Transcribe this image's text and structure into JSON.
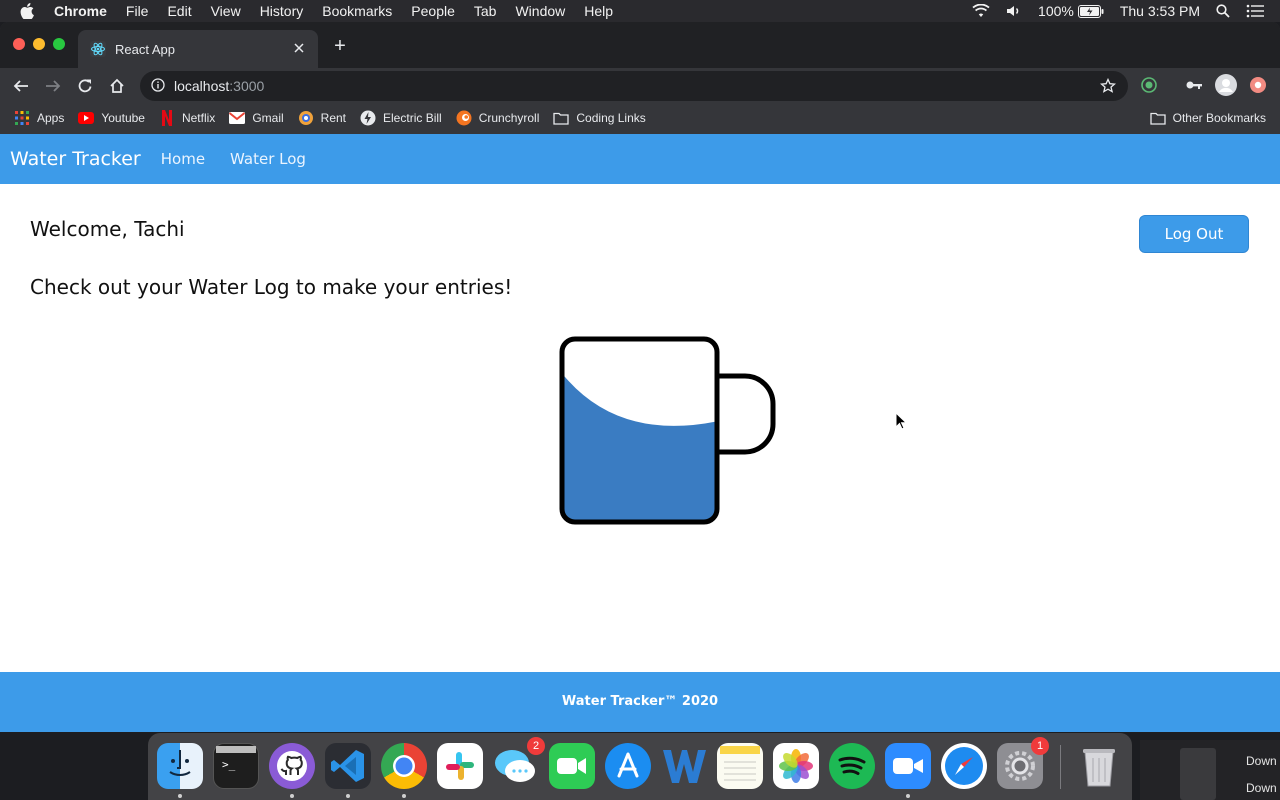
{
  "menubar": {
    "items": [
      "Chrome",
      "File",
      "Edit",
      "View",
      "History",
      "Bookmarks",
      "People",
      "Tab",
      "Window",
      "Help"
    ],
    "battery": "100%",
    "clock": "Thu 3:53 PM"
  },
  "browser": {
    "tab_title": "React App",
    "new_tab_symbol": "+",
    "url_host": "localhost",
    "url_port": ":3000",
    "bookmarks": [
      "Apps",
      "Youtube",
      "Netflix",
      "Gmail",
      "Rent",
      "Electric Bill",
      "Crunchyroll",
      "Coding Links"
    ],
    "other_bookmarks": "Other Bookmarks"
  },
  "page": {
    "brand": "Water Tracker",
    "nav": [
      "Home",
      "Water Log"
    ],
    "welcome": "Welcome, Tachi",
    "hint": "Check out your Water Log to make your entries!",
    "logout_label": "Log Out",
    "footer": "Water Tracker™ 2020",
    "mug_fill_fraction": 0.55
  },
  "dock": {
    "apps": [
      "finder-icon",
      "terminal-icon",
      "github-desktop-icon",
      "vscode-icon",
      "chrome-icon",
      "slack-icon",
      "messages-icon",
      "facetime-icon",
      "app-store-icon",
      "word-icon",
      "notes-icon",
      "photos-icon",
      "spotify-icon",
      "zoom-icon",
      "safari-icon",
      "system-preferences-icon",
      "trash-icon"
    ],
    "messages_badge": "2",
    "system_preferences_badge": "1",
    "downloads_label": "Down"
  },
  "colors": {
    "primary": "#3d9be9",
    "water": "#3a7cc2"
  }
}
